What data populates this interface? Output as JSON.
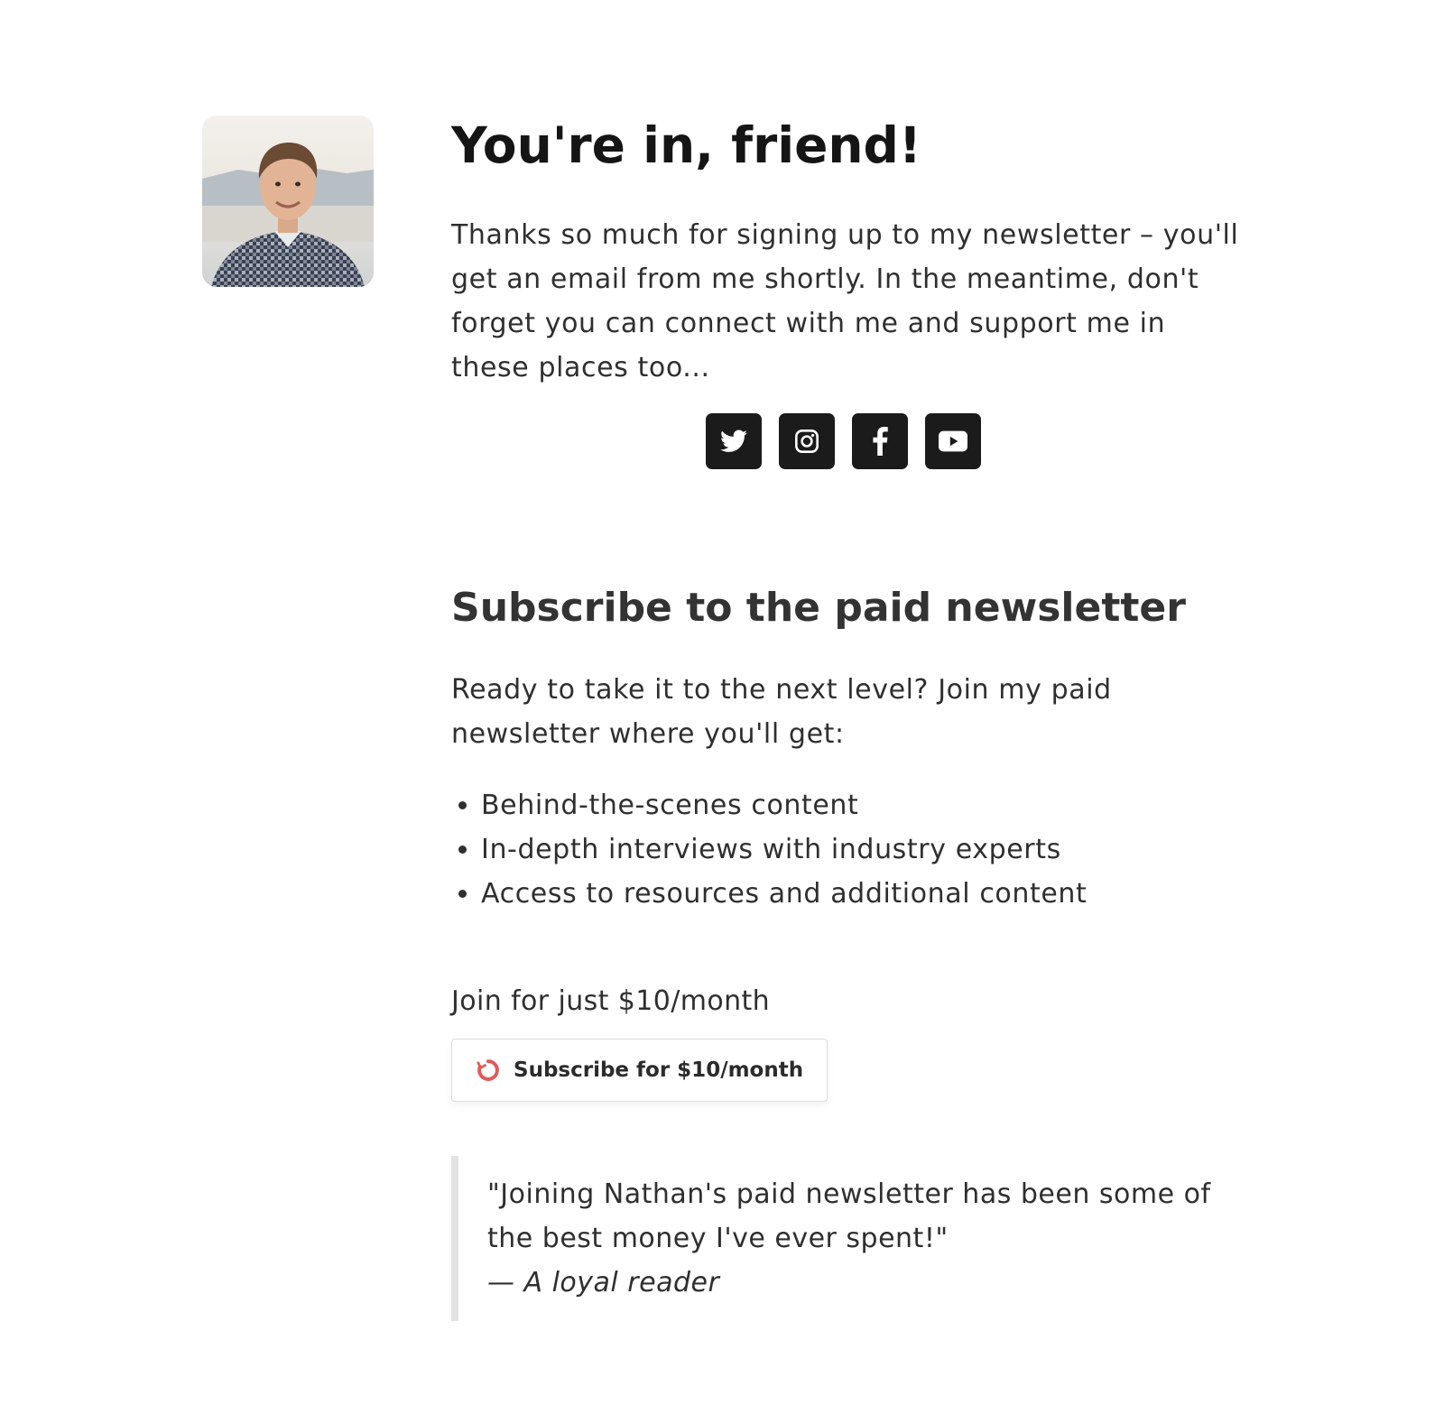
{
  "header": {
    "title": "You're in, friend!",
    "intro": "Thanks so much for signing up to my newsletter – you'll get an email from me shortly. In the meantime, don't forget you can connect with me and support me in these places too..."
  },
  "social": [
    {
      "icon": "twitter-icon"
    },
    {
      "icon": "instagram-icon"
    },
    {
      "icon": "facebook-icon"
    },
    {
      "icon": "youtube-icon"
    }
  ],
  "paid": {
    "title": "Subscribe to the paid newsletter",
    "lead": "Ready to take it to the next level? Join my paid newsletter where you'll get:",
    "benefits": [
      "Behind-the-scenes content",
      "In-depth interviews with industry experts",
      "Access to resources and additional content"
    ],
    "price_text": "Join for just $10/month",
    "button_label": "Subscribe for $10/month",
    "button_icon": "refresh-circle-icon",
    "button_icon_color": "#e05a5a"
  },
  "testimonial": {
    "quote": "\"Joining Nathan's paid newsletter has been some of the best money I've ever spent!\"",
    "attribution": "— A loyal reader"
  }
}
